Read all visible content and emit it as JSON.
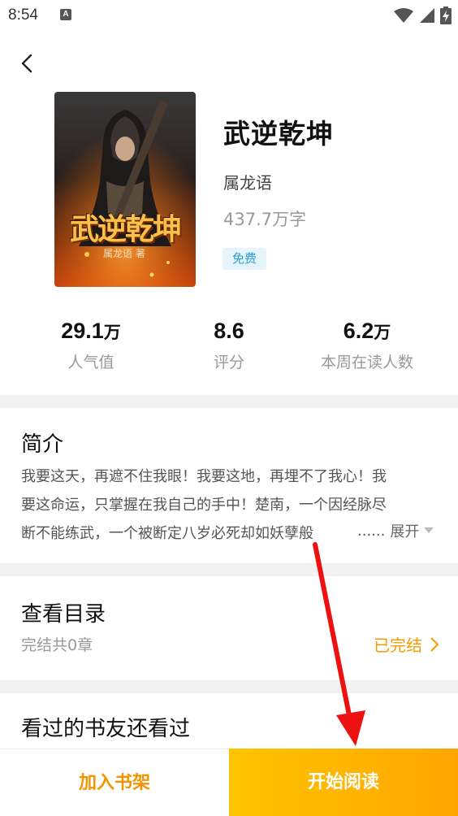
{
  "status_bar": {
    "time": "8:54",
    "notification_badge": "A",
    "icons": [
      "wifi-icon",
      "signal-icon",
      "battery-charging-icon"
    ]
  },
  "header": {
    "back_icon": "chevron-left-icon"
  },
  "book": {
    "cover_title_art": "武逆乾坤",
    "cover_author_art": "属龙语 著",
    "title": "武逆乾坤",
    "author": "属龙语",
    "word_count": "437.7万字",
    "badge": "免费"
  },
  "stats": [
    {
      "value": "29.1",
      "unit": "万",
      "label": "人气值"
    },
    {
      "value": "8.6",
      "unit": "",
      "label": "评分"
    },
    {
      "value": "6.2",
      "unit": "万",
      "label": "本周在读人数"
    }
  ],
  "intro": {
    "title": "简介",
    "lines": [
      "我要这天，再遮不住我眼！我要这地，再埋不了我心！我",
      "要这命运，只掌握在我自己的手中！楚南，一个因经脉尽",
      "断不能练武，一个被断定八岁必死却如妖孽般"
    ],
    "ellipsis": "......",
    "expand_label": "展开"
  },
  "catalog": {
    "title": "查看目录",
    "summary": "完结共0章",
    "status": "已完结"
  },
  "recommend": {
    "title": "看过的书友还看过"
  },
  "actions": {
    "add_to_shelf": "加入书架",
    "start_reading": "开始阅读"
  },
  "colors": {
    "accent_orange": "#f59d00",
    "read_button_start": "#ffc400",
    "read_button_end": "#ffa500",
    "badge_bg": "#e6f4fb",
    "badge_text": "#2a9fd6",
    "annotation_arrow": "#ee1111"
  }
}
